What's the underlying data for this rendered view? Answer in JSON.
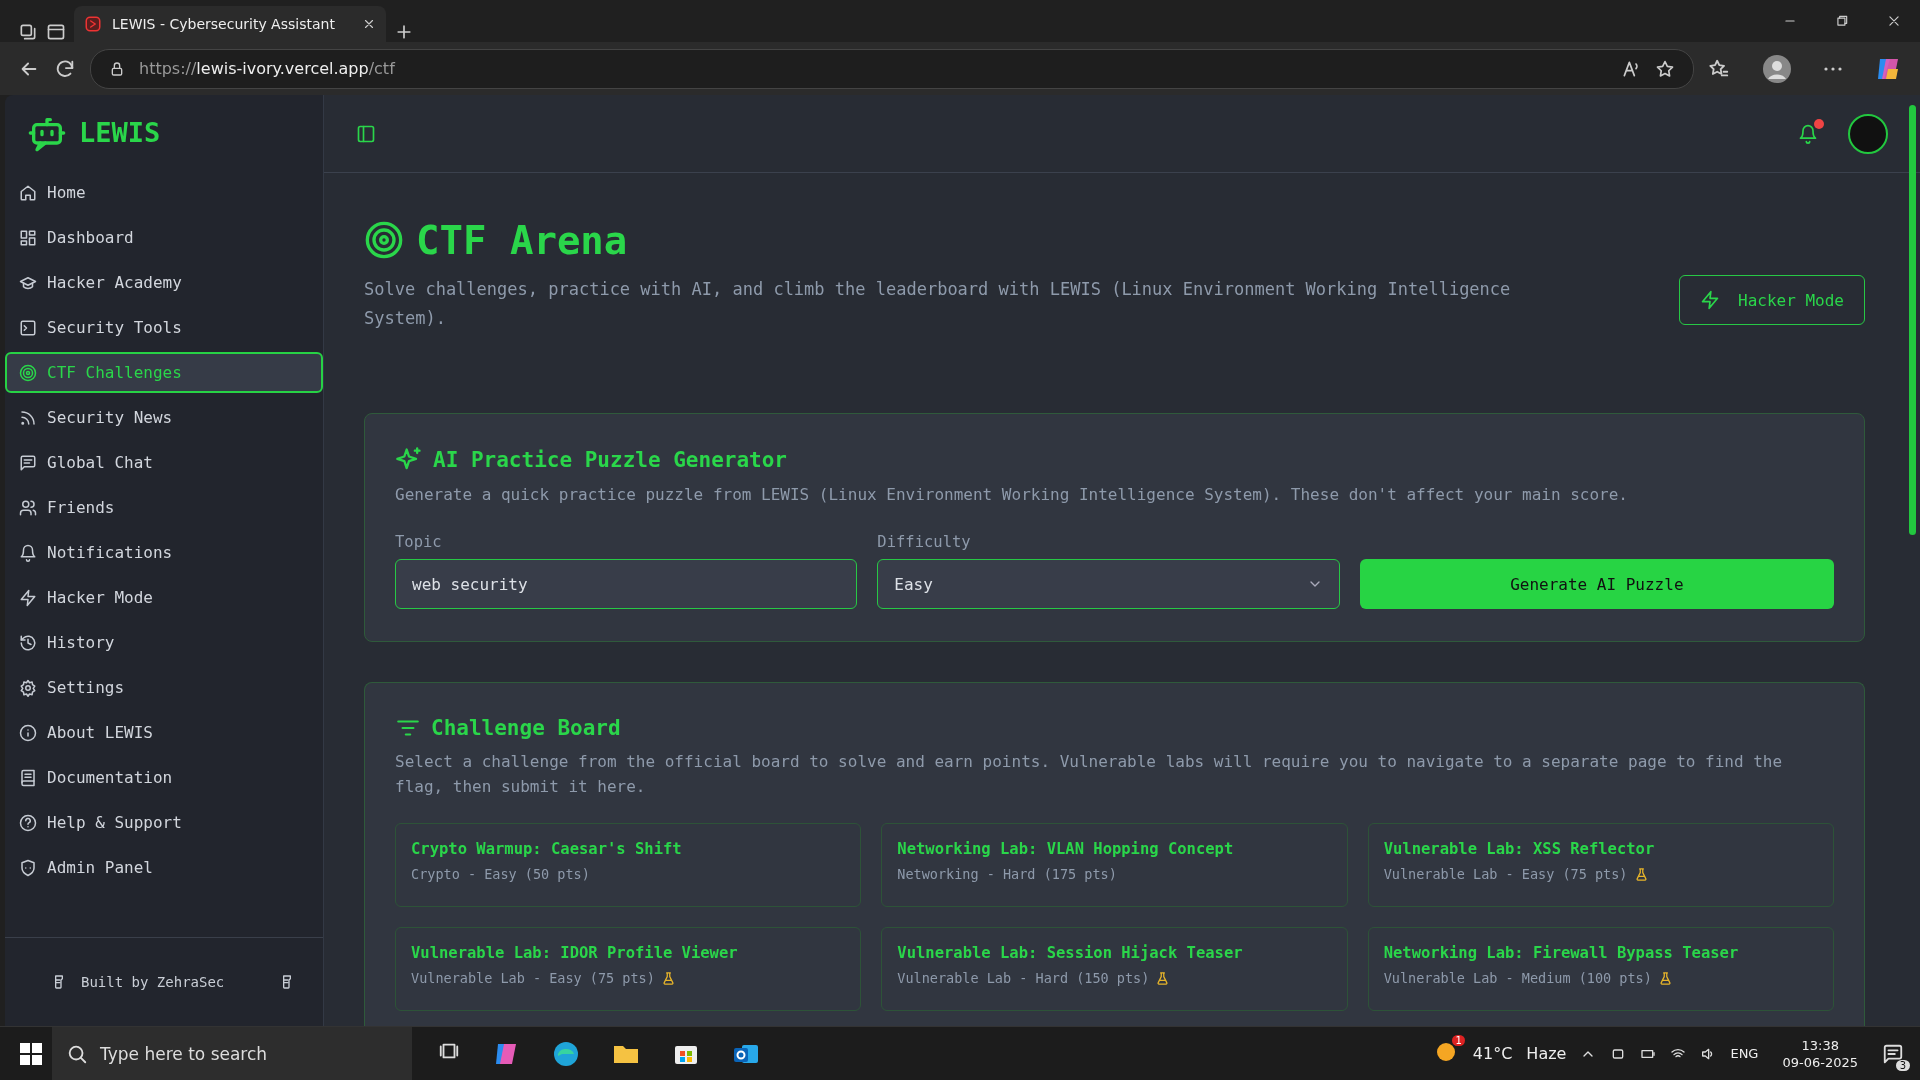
{
  "browser": {
    "tab_title": "LEWIS - Cybersecurity Assistant",
    "url_scheme": "https://",
    "url_host": "lewis-ivory.vercel.app",
    "url_path": "/ctf"
  },
  "sidebar": {
    "brand": "LEWIS",
    "items": [
      {
        "label": "Home",
        "selected": false
      },
      {
        "label": "Dashboard",
        "selected": false
      },
      {
        "label": "Hacker Academy",
        "selected": false
      },
      {
        "label": "Security Tools",
        "selected": false
      },
      {
        "label": "CTF Challenges",
        "selected": true
      },
      {
        "label": "Security News",
        "selected": false
      },
      {
        "label": "Global Chat",
        "selected": false
      },
      {
        "label": "Friends",
        "selected": false
      },
      {
        "label": "Notifications",
        "selected": false
      },
      {
        "label": "Hacker Mode",
        "selected": false
      },
      {
        "label": "History",
        "selected": false
      },
      {
        "label": "Settings",
        "selected": false
      },
      {
        "label": "About LEWIS",
        "selected": false
      },
      {
        "label": "Documentation",
        "selected": false
      },
      {
        "label": "Help & Support",
        "selected": false
      },
      {
        "label": "Admin Panel",
        "selected": false
      }
    ],
    "footer": "Built by ZehraSec"
  },
  "topbar": {
    "has_unread": true
  },
  "hero": {
    "title": "CTF Arena",
    "subtitle": "Solve challenges, practice with AI, and climb the leaderboard with LEWIS (Linux Environment Working Intelligence System).",
    "button": "Hacker Mode"
  },
  "puzzle": {
    "title": "AI Practice Puzzle Generator",
    "description": "Generate a quick practice puzzle from LEWIS (Linux Environment Working Intelligence System). These don't affect your main score.",
    "topic": {
      "label": "Topic",
      "value": "web security"
    },
    "difficulty": {
      "label": "Difficulty",
      "value": "Easy"
    },
    "button": "Generate AI Puzzle"
  },
  "board": {
    "title": "Challenge Board",
    "description": "Select a challenge from the official board to solve and earn points. Vulnerable labs will require you to navigate to a separate page to find the flag, then submit it here.",
    "challenges": [
      {
        "title": "Crypto Warmup: Caesar's Shift",
        "meta": "Crypto - Easy (50 pts)",
        "lab": false
      },
      {
        "title": "Networking Lab: VLAN Hopping Concept",
        "meta": "Networking - Hard (175 pts)",
        "lab": false
      },
      {
        "title": "Vulnerable Lab: XSS Reflector",
        "meta": "Vulnerable Lab - Easy (75 pts)",
        "lab": true
      },
      {
        "title": "Vulnerable Lab: IDOR Profile Viewer",
        "meta": "Vulnerable Lab - Easy (75 pts)",
        "lab": true
      },
      {
        "title": "Vulnerable Lab: Session Hijack Teaser",
        "meta": "Vulnerable Lab - Hard (150 pts)",
        "lab": true
      },
      {
        "title": "Networking Lab: Firewall Bypass Teaser",
        "meta": "Vulnerable Lab - Medium (100 pts)",
        "lab": true
      }
    ]
  },
  "taskbar": {
    "search_placeholder": "Type here to search",
    "weather_badge": "1",
    "temperature": "41°C",
    "condition": "Haze",
    "language": "ENG",
    "time": "13:38",
    "date": "09-06-2025",
    "notification_count": "3"
  }
}
